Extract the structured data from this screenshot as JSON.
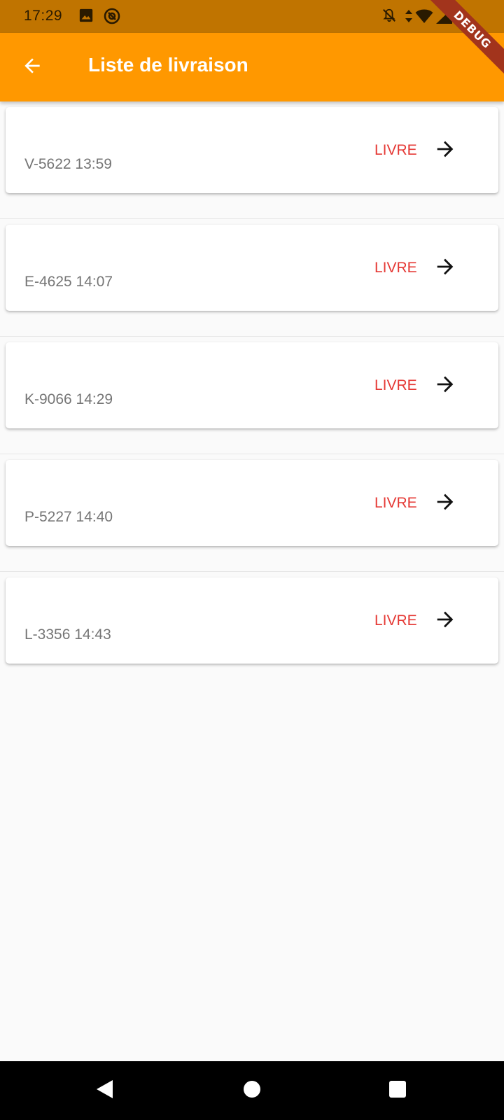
{
  "status_bar": {
    "time": "17:29",
    "icons": [
      "image-icon",
      "at-sign-icon",
      "bell-off-icon",
      "data-arrows-icon",
      "wifi-icon",
      "signal-icon"
    ]
  },
  "debug_banner": "DEBUG",
  "app_bar": {
    "title": "Liste de livraison",
    "back_icon": "arrow-back-icon",
    "background": "#ff9800"
  },
  "deliveries": [
    {
      "label": "V-5622 13:59",
      "status": "LIVRE"
    },
    {
      "label": "E-4625 14:07",
      "status": "LIVRE"
    },
    {
      "label": "K-9066 14:29",
      "status": "LIVRE"
    },
    {
      "label": "P-5227 14:40",
      "status": "LIVRE"
    },
    {
      "label": "L-3356 14:43",
      "status": "LIVRE"
    }
  ],
  "colors": {
    "status_bar": "#c07400",
    "status_text": "#e53935",
    "label_text": "#757575"
  },
  "nav_bar": {
    "buttons": [
      "back-triangle-icon",
      "home-circle-icon",
      "recents-square-icon"
    ]
  }
}
